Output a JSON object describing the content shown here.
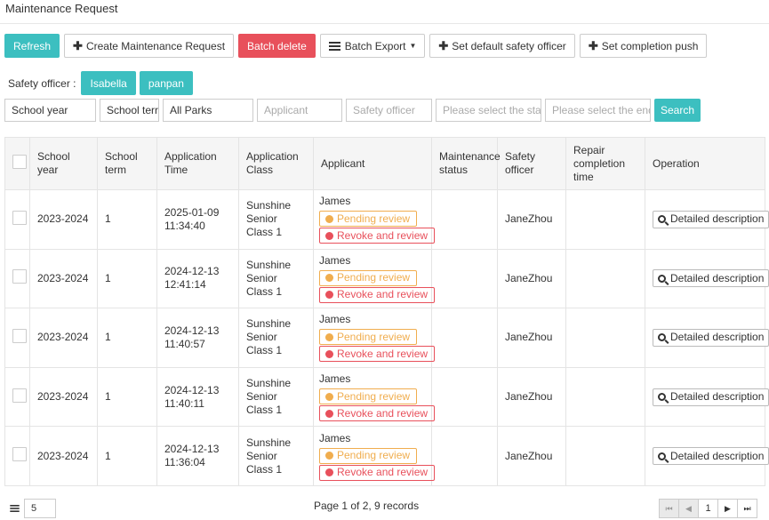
{
  "page": {
    "title": "Maintenance Request"
  },
  "toolbar": {
    "refresh": "Refresh",
    "create": "Create Maintenance Request",
    "batch_delete": "Batch delete",
    "batch_export": "Batch Export",
    "set_default_officer": "Set default safety officer",
    "set_completion_push": "Set completion push"
  },
  "safety": {
    "label": "Safety officer :",
    "officers": [
      "Isabella",
      "panpan"
    ]
  },
  "filters": {
    "school_year": "School year",
    "school_term": "School terr",
    "parks": "All Parks",
    "applicant_ph": "Applicant",
    "officer_ph": "Safety officer",
    "start_ph": "Please select the start",
    "end_ph": "Please select the end .",
    "search": "Search"
  },
  "table": {
    "headers": [
      "School year",
      "School term",
      "Application Time",
      "Application Class",
      "Applicant",
      "Maintenance status",
      "Safety officer",
      "Repair completion time",
      "Operation"
    ],
    "rows": [
      {
        "year": "2023-2024",
        "term": "1",
        "time": "2025-01-09 11:34:40",
        "class": "Sunshine Senior Class 1",
        "applicant": "James",
        "pending": "Pending review",
        "revoke": "Revoke and review",
        "status": "",
        "officer": "JaneZhou",
        "completion": "",
        "op": "Detailed description"
      },
      {
        "year": "2023-2024",
        "term": "1",
        "time": "2024-12-13 12:41:14",
        "class": "Sunshine Senior Class 1",
        "applicant": "James",
        "pending": "Pending review",
        "revoke": "Revoke and review",
        "status": "",
        "officer": "JaneZhou",
        "completion": "",
        "op": "Detailed description"
      },
      {
        "year": "2023-2024",
        "term": "1",
        "time": "2024-12-13 11:40:57",
        "class": "Sunshine Senior Class 1",
        "applicant": "James",
        "pending": "Pending review",
        "revoke": "Revoke and review",
        "status": "",
        "officer": "JaneZhou",
        "completion": "",
        "op": "Detailed description"
      },
      {
        "year": "2023-2024",
        "term": "1",
        "time": "2024-12-13 11:40:11",
        "class": "Sunshine Senior Class 1",
        "applicant": "James",
        "pending": "Pending review",
        "revoke": "Revoke and review",
        "status": "",
        "officer": "JaneZhou",
        "completion": "",
        "op": "Detailed description"
      },
      {
        "year": "2023-2024",
        "term": "1",
        "time": "2024-12-13 11:36:04",
        "class": "Sunshine Senior Class 1",
        "applicant": "James",
        "pending": "Pending review",
        "revoke": "Revoke and review",
        "status": "",
        "officer": "JaneZhou",
        "completion": "",
        "op": "Detailed description"
      }
    ]
  },
  "footer": {
    "page_size": "5",
    "page_info": "Page 1 of 2, 9 records",
    "current_page": "1"
  },
  "colors": {
    "accent": "#3cbfc0",
    "danger": "#e8505b",
    "warning": "#f0ad4e"
  }
}
